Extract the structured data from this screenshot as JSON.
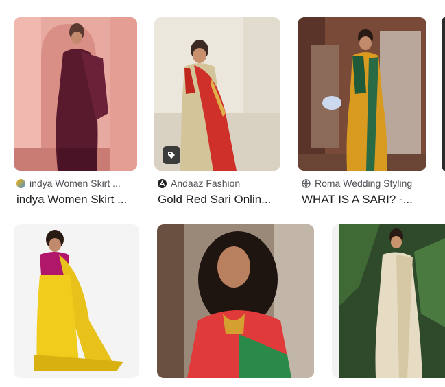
{
  "results": [
    {
      "source": "indya Women Skirt ...",
      "title": "indya Women Skirt ...",
      "favicon": "indya-favicon-icon"
    },
    {
      "source": "Andaaz Fashion",
      "title": "Gold Red Sari Onlin...",
      "favicon": "andaaz-favicon-icon",
      "badge": "shopping-tag-icon"
    },
    {
      "source": "Roma Wedding Styling",
      "title": "WHAT IS A SARI? -...",
      "favicon": "globe-icon"
    }
  ],
  "colors": {
    "text": "#202124",
    "source": "#4d5156"
  }
}
